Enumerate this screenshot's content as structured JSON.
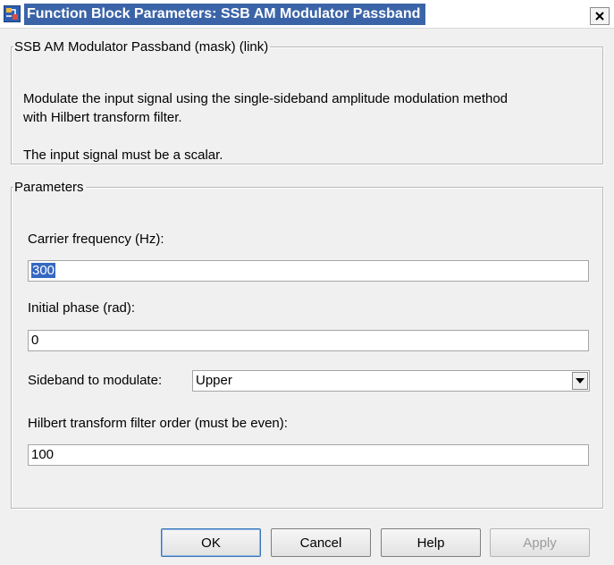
{
  "window": {
    "title": "Function Block Parameters: SSB AM Modulator Passband",
    "icon": "simulink-block-icon",
    "close_icon": "close-icon"
  },
  "description": {
    "legend": "SSB AM Modulator Passband (mask) (link)",
    "line1": "Modulate the input signal using the single-sideband amplitude modulation method",
    "line2": "with Hilbert transform filter.",
    "line3": "The input signal must be a scalar."
  },
  "parameters": {
    "legend": "Parameters",
    "carrier_frequency": {
      "label": "Carrier frequency (Hz):",
      "value": "300"
    },
    "initial_phase": {
      "label": "Initial phase (rad):",
      "value": "0"
    },
    "sideband": {
      "label": "Sideband to modulate:",
      "value": "Upper"
    },
    "filter_order": {
      "label": "Hilbert transform filter order (must be even):",
      "value": "100"
    }
  },
  "buttons": {
    "ok": "OK",
    "cancel": "Cancel",
    "help": "Help",
    "apply": "Apply"
  }
}
